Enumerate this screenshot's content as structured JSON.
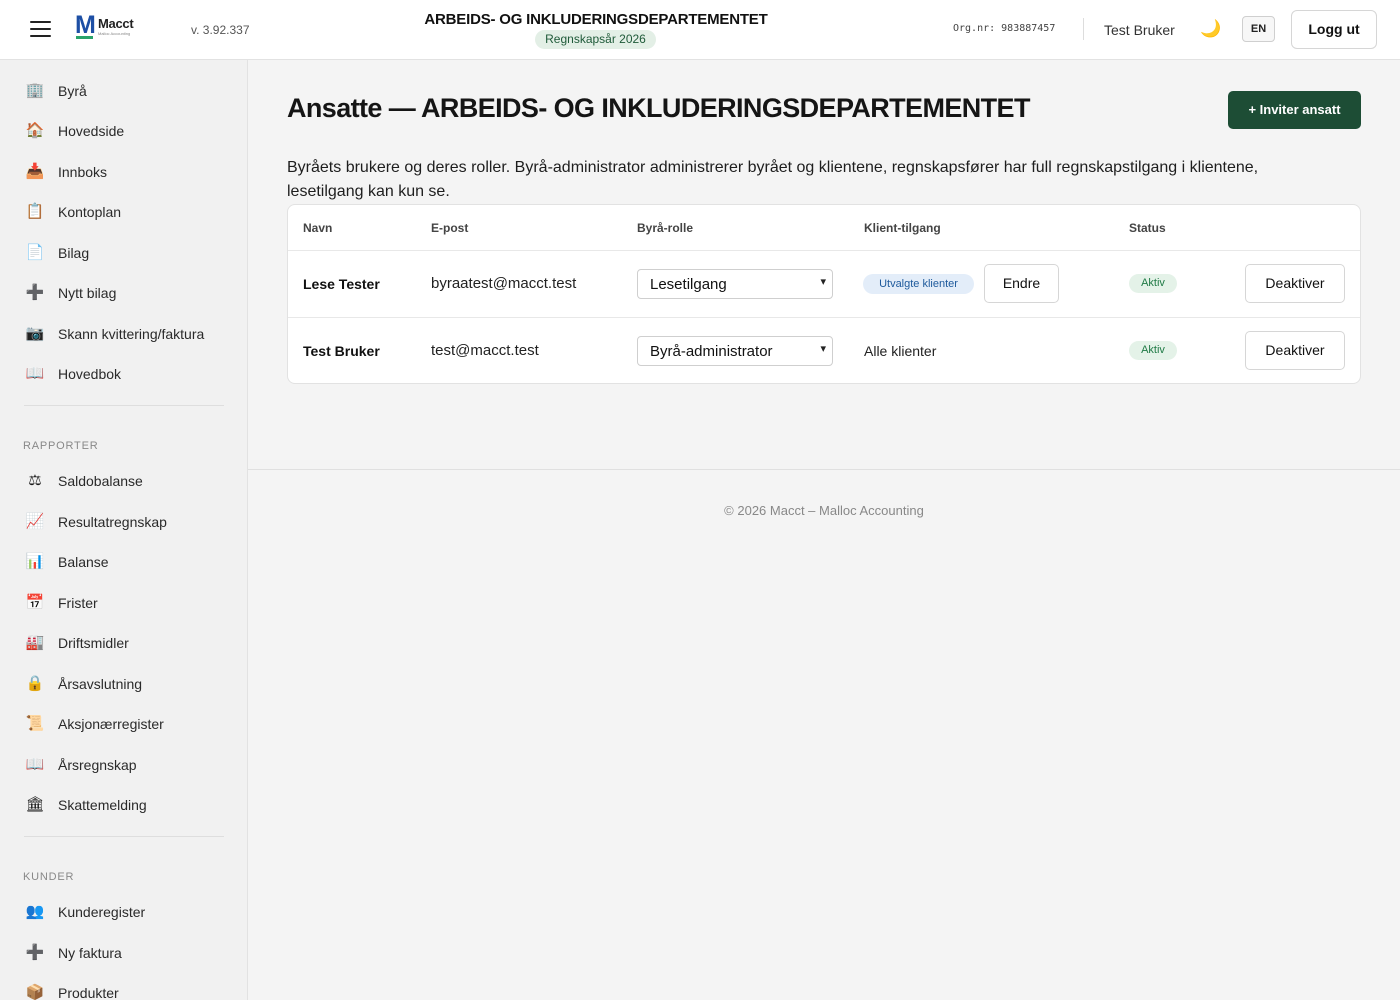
{
  "header": {
    "app_name": "Macct",
    "app_tagline": "Malloc Accounting",
    "version": "v. 3.92.337",
    "org_title": "ARBEIDS- OG INKLUDERINGSDEPARTEMENTET",
    "fiscal_year": "Regnskapsår 2026",
    "org_nr": "Org.nr: 983887457",
    "user_name": "Test Bruker",
    "theme_icon": "🌙",
    "lang_button": "EN",
    "logout_button": "Logg ut",
    "brand_color": "#1d4fa5"
  },
  "sidebar": {
    "items": [
      {
        "icon": "🏢",
        "label": "Byrå"
      },
      {
        "icon": "🏠",
        "label": "Hovedside"
      },
      {
        "icon": "📥",
        "label": "Innboks"
      },
      {
        "icon": "📋",
        "label": "Kontoplan"
      },
      {
        "icon": "📄",
        "label": "Bilag"
      },
      {
        "icon": "➕",
        "label": "Nytt bilag"
      },
      {
        "icon": "📷",
        "label": "Skann kvittering/faktura"
      },
      {
        "icon": "📖",
        "label": "Hovedbok"
      }
    ],
    "reports_title": "RAPPORTER",
    "reports": [
      {
        "icon": "⚖",
        "label": "Saldobalanse"
      },
      {
        "icon": "📈",
        "label": "Resultatregnskap"
      },
      {
        "icon": "📊",
        "label": "Balanse"
      },
      {
        "icon": "📅",
        "label": "Frister"
      },
      {
        "icon": "🏭",
        "label": "Driftsmidler"
      },
      {
        "icon": "🔒",
        "label": "Årsavslutning"
      },
      {
        "icon": "📜",
        "label": "Aksjonærregister"
      },
      {
        "icon": "📖",
        "label": "Årsregnskap"
      },
      {
        "icon": "🏛",
        "label": "Skattemelding"
      }
    ],
    "customers_title": "KUNDER",
    "customers": [
      {
        "icon": "👥",
        "label": "Kunderegister"
      },
      {
        "icon": "➕",
        "label": "Ny faktura"
      },
      {
        "icon": "📦",
        "label": "Produkter"
      }
    ]
  },
  "main": {
    "title": "Ansatte — ARBEIDS- OG INKLUDERINGSDEPARTEMENTET",
    "invite_button": "+ Inviter ansatt",
    "description": "Byråets brukere og deres roller. Byrå-administrator administrerer byrået og klientene, regnskapsfører har full regnskapstilgang i klientene, lesetilgang kan kun se.",
    "table": {
      "columns": [
        "Navn",
        "E-post",
        "Byrå-rolle",
        "Klient-tilgang",
        "Status"
      ],
      "rows": [
        {
          "name": "Lese Tester",
          "email": "byraatest@macct.test",
          "role": "Lesetilgang",
          "access_pill": "Utvalgte klienter",
          "edit_button": "Endre",
          "status": "Aktiv",
          "action": "Deaktiver"
        },
        {
          "name": "Test Bruker",
          "email": "test@macct.test",
          "role": "Byrå-administrator",
          "access": "Alle klienter",
          "status": "Aktiv",
          "action": "Deaktiver"
        }
      ]
    },
    "accent_color": "#1d4d35"
  },
  "footer": {
    "text": "© 2026 Macct – Malloc Accounting"
  }
}
